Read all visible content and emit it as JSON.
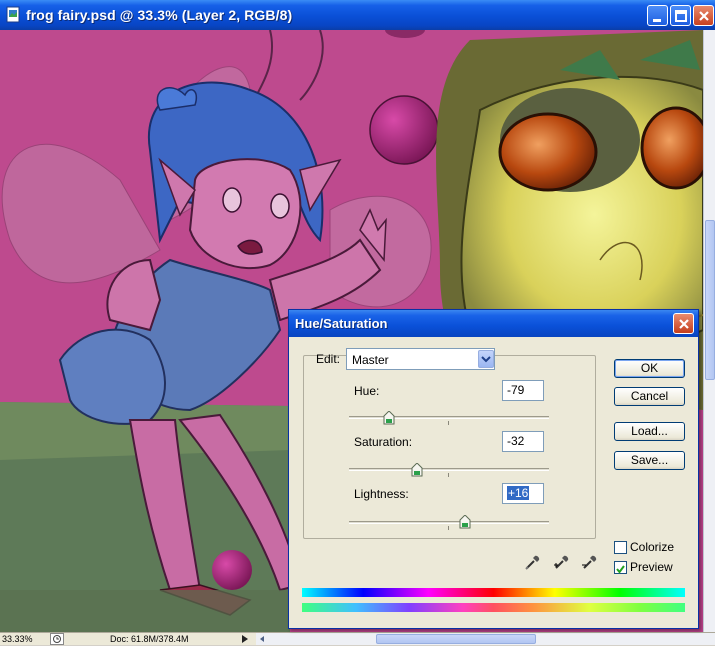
{
  "window": {
    "title": "frog fairy.psd @ 33.3% (Layer 2, RGB/8)"
  },
  "statusbar": {
    "zoom": "33.33%",
    "doc_size": "Doc: 61.8M/378.4M"
  },
  "dialog": {
    "title": "Hue/Saturation",
    "edit_label": "Edit:",
    "edit_value": "Master",
    "hue_label": "Hue:",
    "hue_value": "-79",
    "hue_fraction": 0.2,
    "saturation_label": "Saturation:",
    "saturation_value": "-32",
    "saturation_fraction": 0.34,
    "lightness_label": "Lightness:",
    "lightness_value": "+16",
    "lightness_fraction": 0.58,
    "ok_label": "OK",
    "cancel_label": "Cancel",
    "load_label": "Load...",
    "save_label": "Save...",
    "colorize_label": "Colorize",
    "colorize_checked": false,
    "preview_label": "Preview",
    "preview_checked": true
  }
}
